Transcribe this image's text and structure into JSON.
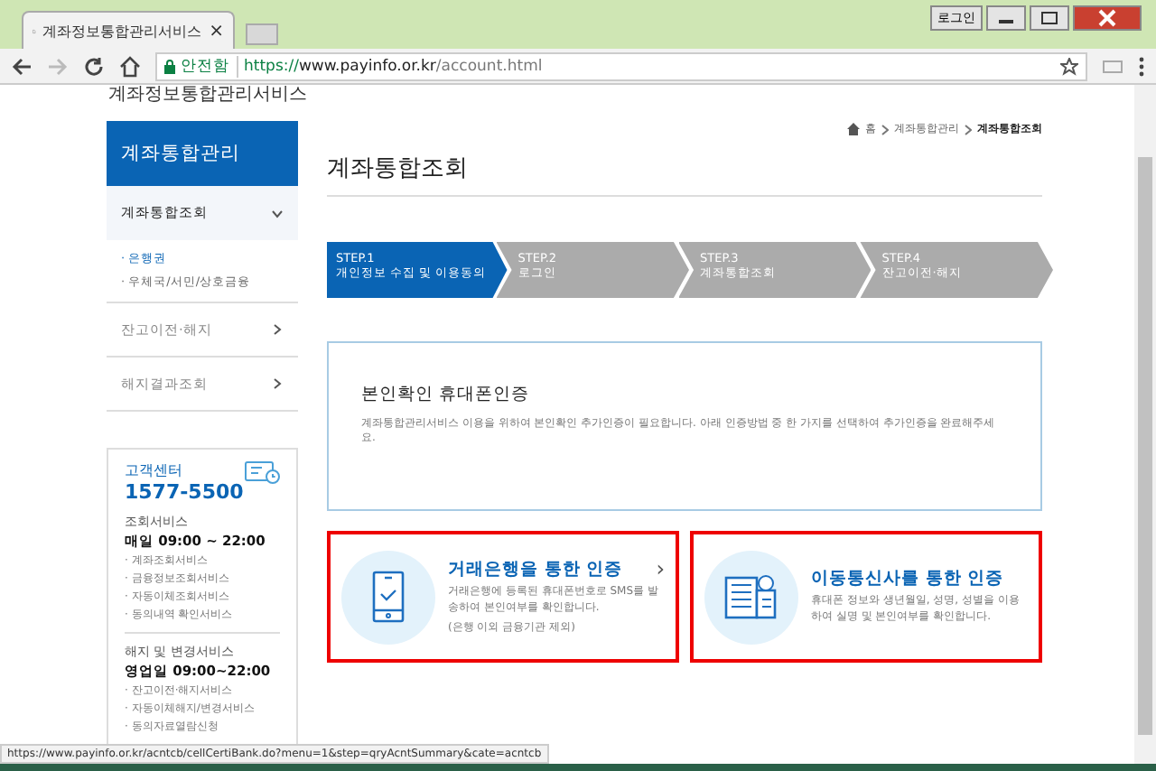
{
  "browser": {
    "tab_title": "계좌정보통합관리서비스",
    "tab_close": "×",
    "secure_label": "안전함",
    "url_scheme": "https://",
    "url_host": "www.payinfo.or.kr",
    "url_path": "/account.html",
    "window_buttons": [
      "로그인"
    ]
  },
  "site_header": {
    "logo_text": "계좌정보통합관리서비스"
  },
  "sidebar": {
    "title": "계좌통합관리",
    "items": [
      {
        "label": "계좌통합조회",
        "expanded": true,
        "selected": true,
        "children": [
          {
            "label": "· 은행권",
            "selected": true
          },
          {
            "label": "· 우체국/서민/상호금융",
            "selected": false
          }
        ]
      },
      {
        "label": "잔고이전·해지",
        "expanded": false,
        "selected": false
      },
      {
        "label": "해지결과조회",
        "expanded": false,
        "selected": false
      }
    ]
  },
  "support": {
    "title": "고객센터",
    "phone": "1577-5500",
    "sections": [
      {
        "title": "조회서비스",
        "hours": "매일 09:00 ~ 22:00",
        "items": [
          "· 계좌조회서비스",
          "· 금융정보조회서비스",
          "· 자동이체조회서비스",
          "· 동의내역 확인서비스"
        ]
      },
      {
        "title": "해지 및 변경서비스",
        "hours": "영업일 09:00~22:00",
        "items": [
          "· 잔고이전·해지서비스",
          "· 자동이체해지/변경서비스",
          "· 동의자료열람신청"
        ]
      }
    ]
  },
  "breadcrumb": [
    {
      "label": "홈",
      "current": false
    },
    {
      "label": "계좌통합관리",
      "current": false
    },
    {
      "label": "계좌통합조회",
      "current": true
    }
  ],
  "page_title": "계좌통합조회",
  "steps": [
    {
      "step": "STEP.1",
      "label": "개인정보 수집 및 이용동의",
      "selected": true
    },
    {
      "step": "STEP.2",
      "label": "로그인",
      "selected": false
    },
    {
      "step": "STEP.3",
      "label": "계좌통합조회",
      "selected": false
    },
    {
      "step": "STEP.4",
      "label": "잔고이전·해지",
      "selected": false
    }
  ],
  "notice": {
    "title": "본인확인 휴대폰인증",
    "text": "계좌통합관리서비스 이용을 위하여 본인확인 추가인증이 필요합니다. 아래 인증방법 중 한 가지를 선택하여 추가인증을 완료해주세요."
  },
  "options": [
    {
      "kind": "phone",
      "title": "거래은행을 통한 인증",
      "lines": [
        "거래은행에 등록된 휴대폰번호로 SMS를 발송하여 본인여부를 확인합니다.",
        "(은행 이외 금융기관 제외)"
      ],
      "arrow": "›"
    },
    {
      "kind": "building",
      "title": "이동통신사를 통한 인증",
      "lines": [
        "휴대폰 정보와 생년월일, 성명, 성별을 이용하여 실명 및 본인여부를 확인합니다."
      ]
    }
  ],
  "status_url": "https://www.payinfo.or.kr/acntcb/cellCertiBank.do?menu=1&step=qryAcntSummary&cate=acntcb"
}
